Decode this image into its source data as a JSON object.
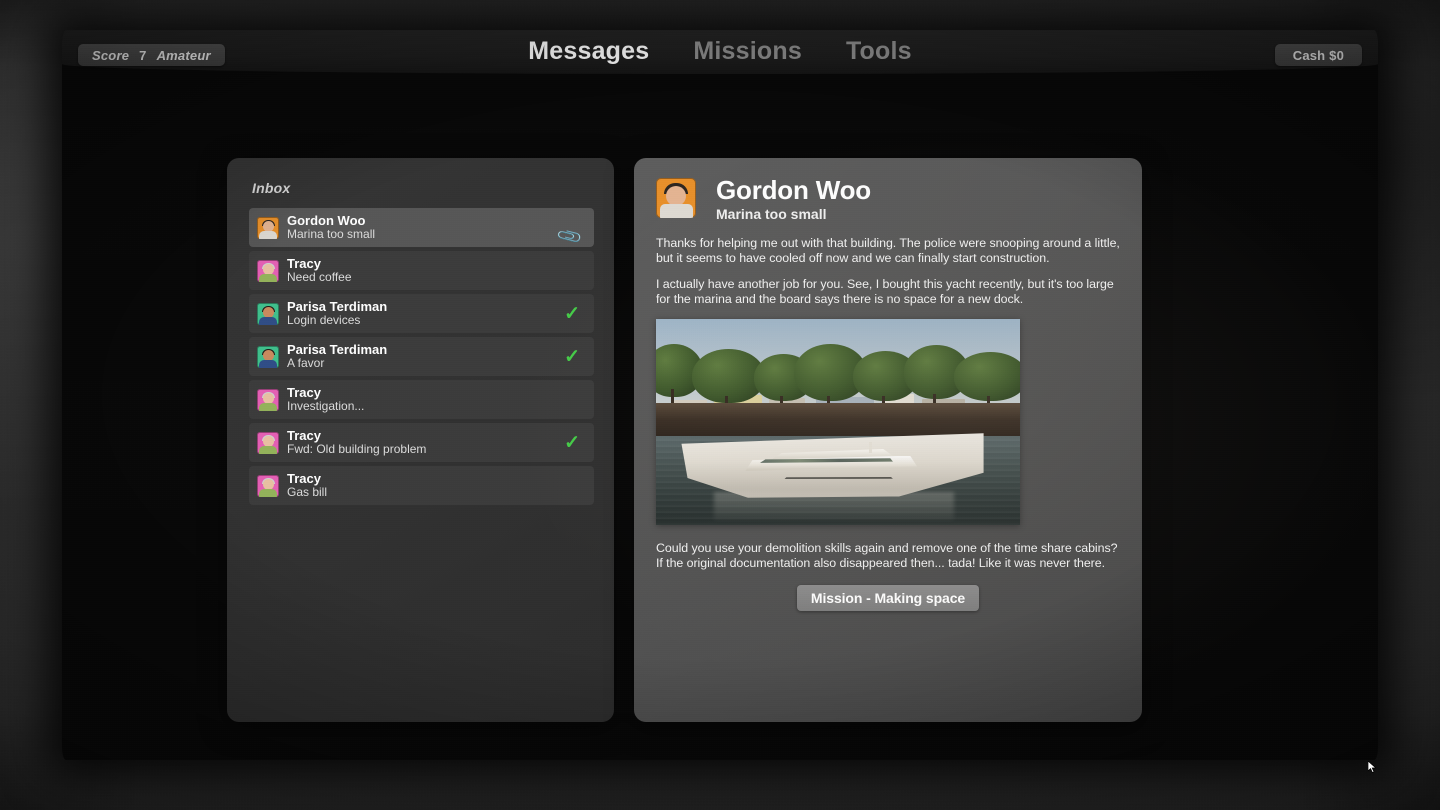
{
  "topbar": {
    "score": {
      "label": "Score",
      "value": "7",
      "rank": "Amateur"
    },
    "cash": "Cash $0",
    "nav": [
      {
        "label": "Messages",
        "active": true
      },
      {
        "label": "Missions",
        "active": false
      },
      {
        "label": "Tools",
        "active": false
      }
    ]
  },
  "inbox": {
    "title": "Inbox",
    "messages": [
      {
        "sender": "Gordon Woo",
        "subject": "Marina too small",
        "avatar": "gordon",
        "flag": "paperclip-icon",
        "selected": true
      },
      {
        "sender": "Tracy",
        "subject": "Need coffee",
        "avatar": "tracy",
        "flag": "none",
        "selected": false
      },
      {
        "sender": "Parisa Terdiman",
        "subject": "Login devices",
        "avatar": "parisa",
        "flag": "check-icon",
        "selected": false
      },
      {
        "sender": "Parisa Terdiman",
        "subject": "A favor",
        "avatar": "parisa",
        "flag": "check-icon",
        "selected": false
      },
      {
        "sender": "Tracy",
        "subject": "Investigation...",
        "avatar": "tracy",
        "flag": "none",
        "selected": false
      },
      {
        "sender": "Tracy",
        "subject": "Fwd: Old building problem",
        "avatar": "tracy",
        "flag": "check-icon",
        "selected": false
      },
      {
        "sender": "Tracy",
        "subject": "Gas bill",
        "avatar": "tracy",
        "flag": "none",
        "selected": false
      }
    ]
  },
  "reader": {
    "sender": "Gordon Woo",
    "subject": "Marina too small",
    "avatar": "gordon",
    "paragraph1": "Thanks for helping me out with that building. The police were snooping around a little, but it seems to have cooled off now and we can finally start construction.",
    "paragraph2": "I actually have another job for you. See, I bought this yacht recently, but it's too large for the marina and the board says there is no space for a new dock.",
    "image_alt": "photo of a large white yacht moored beside a stone seawall with trees behind",
    "paragraph3": "Could you use your demolition skills again and remove one of the time share cabins? If the original documentation also disappeared then... tada! Like it was never there.",
    "mission_button": "Mission - Making space"
  },
  "colors": {
    "accent_check": "#45cc48",
    "nav_active": "#ffffff",
    "nav_inactive": "#8b8b8b",
    "reader_panel": "#585858",
    "inbox_panel": "#313131",
    "selected_row": "#565656",
    "avatar_gordon": "#e8902a",
    "avatar_tracy": "#e45fb4",
    "avatar_parisa": "#3fbf8c"
  }
}
